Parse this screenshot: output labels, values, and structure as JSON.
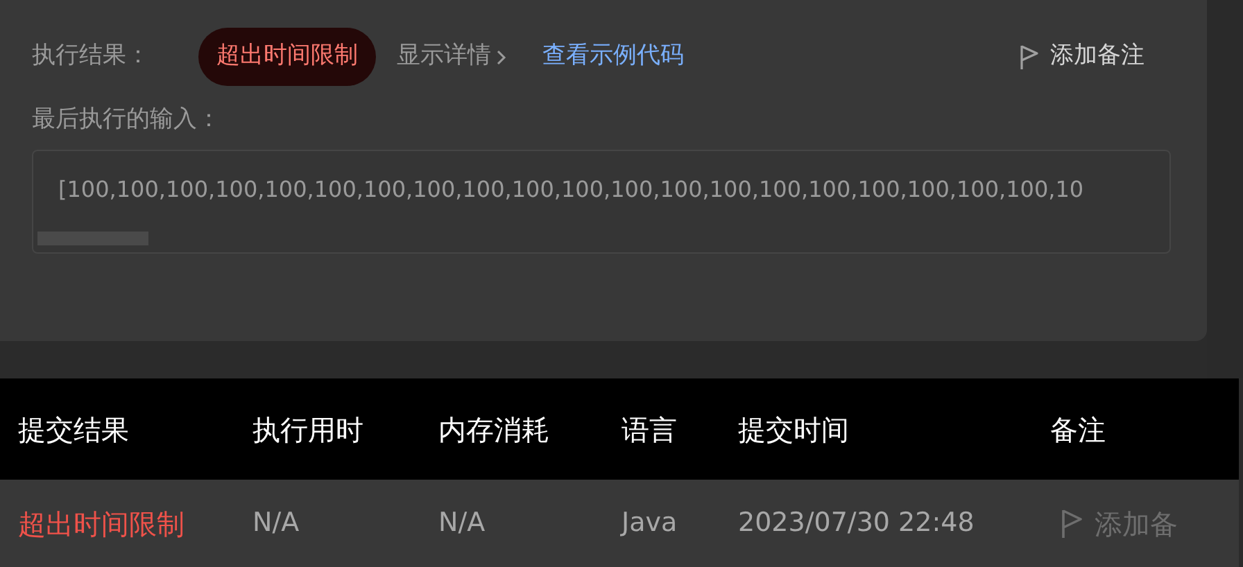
{
  "result": {
    "label": "执行结果：",
    "status": "超出时间限制",
    "details_link": "显示详情",
    "example_link": "查看示例代码",
    "note_button": "添加备注"
  },
  "last_input": {
    "label": "最后执行的输入：",
    "value": "[100,100,100,100,100,100,100,100,100,100,100,100,100,100,100,100,100,100,100,100,10"
  },
  "table": {
    "columns": [
      "提交结果",
      "执行用时",
      "内存消耗",
      "语言",
      "提交时间",
      "备注"
    ],
    "rows": [
      {
        "result": "超出时间限制",
        "runtime": "N/A",
        "memory": "N/A",
        "language": "Java",
        "submitted": "2023/07/30 22:48",
        "note": "添加备"
      }
    ]
  }
}
